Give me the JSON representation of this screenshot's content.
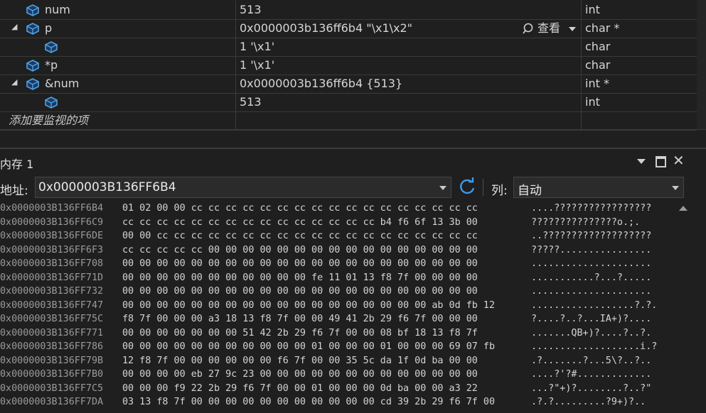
{
  "watch": {
    "rows": [
      {
        "name": "num",
        "value": "513",
        "type": "int"
      },
      {
        "name": "p",
        "value": "0x0000003b136ff6b4 \"\\x1\\x2\"",
        "type": "char *",
        "view_label": "查看"
      },
      {
        "name": "",
        "value": "1 '\\x1'",
        "type": "char"
      },
      {
        "name": "*p",
        "value": "1 '\\x1'",
        "type": "char"
      },
      {
        "name": "&num",
        "value": "0x0000003b136ff6b4 {513}",
        "type": "int *"
      },
      {
        "name": "",
        "value": "513",
        "type": "int"
      }
    ],
    "add_item_label": "添加要监视的项"
  },
  "memory": {
    "title": "内存 1",
    "address_label": "地址:",
    "address_value": "0x0000003B136FF6B4",
    "columns_label": "列:",
    "columns_value": "自动",
    "lines": [
      {
        "addr": "0x0000003B136FF6B4",
        "hex": "01 02 00 00 cc cc cc cc cc cc cc cc cc cc cc cc cc cc cc cc cc",
        "chars": "....?????????????????"
      },
      {
        "addr": "0x0000003B136FF6C9",
        "hex": "cc cc cc cc cc cc cc cc cc cc cc cc cc cc cc b4 f6 6f 13 3b 00",
        "chars": "???????????????o.;."
      },
      {
        "addr": "0x0000003B136FF6DE",
        "hex": "00 00 cc cc cc cc cc cc cc cc cc cc cc cc cc cc cc cc cc cc cc",
        "chars": "..???????????????????"
      },
      {
        "addr": "0x0000003B136FF6F3",
        "hex": "cc cc cc cc cc 00 00 00 00 00 00 00 00 00 00 00 00 00 00 00 00",
        "chars": "?????................"
      },
      {
        "addr": "0x0000003B136FF708",
        "hex": "00 00 00 00 00 00 00 00 00 00 00 00 00 00 00 00 00 00 00 00 00",
        "chars": "....................."
      },
      {
        "addr": "0x0000003B136FF71D",
        "hex": "00 00 00 00 00 00 00 00 00 00 00 fe 11 01 13 f8 7f 00 00 00 00",
        "chars": "...........?...?....."
      },
      {
        "addr": "0x0000003B136FF732",
        "hex": "00 00 00 00 00 00 00 00 00 00 00 00 00 00 00 00 00 00 00 00 00",
        "chars": "....................."
      },
      {
        "addr": "0x0000003B136FF747",
        "hex": "00 00 00 00 00 00 00 00 00 00 00 00 00 00 00 00 00 00 ab 0d fb 12",
        "chars": "..................?.?."
      },
      {
        "addr": "0x0000003B136FF75C",
        "hex": "f8 7f 00 00 00 a3 18 13 f8 7f 00 00 49 41 2b 29 f6 7f 00 00 00",
        "chars": "?....?..?...IA+)?...."
      },
      {
        "addr": "0x0000003B136FF771",
        "hex": "00 00 00 00 00 00 00 51 42 2b 29 f6 7f 00 00 08 bf 18 13 f8 7f",
        "chars": ".......QB+)?....?..?."
      },
      {
        "addr": "0x0000003B136FF786",
        "hex": "00 00 00 00 00 00 00 00 00 00 00 01 00 00 00 01 00 00 00 69 07 fb",
        "chars": "...................i.?"
      },
      {
        "addr": "0x0000003B136FF79B",
        "hex": "12 f8 7f 00 00 00 00 00 00 f6 7f 00 00 35 5c da 1f 0d ba 00 00",
        "chars": ".?.......?...5\\?..?.."
      },
      {
        "addr": "0x0000003B136FF7B0",
        "hex": "00 00 00 00 eb 27 9c 23 00 00 00 00 00 00 00 00 00 00 00 00 00",
        "chars": "....?'?#............."
      },
      {
        "addr": "0x0000003B136FF7C5",
        "hex": "00 00 00 f9 22 2b 29 f6 7f 00 00 01 00 00 00 0d ba 00 00 a3 22",
        "chars": "...?\"+)?........?..?\""
      },
      {
        "addr": "0x0000003B136FF7DA",
        "hex": "03 13 f8 7f 00 00 00 00 00 00 00 00 00 00 00 cd 39 2b 29 f6 7f 00",
        "chars": ".?.?.........?9+)?.."
      }
    ]
  }
}
